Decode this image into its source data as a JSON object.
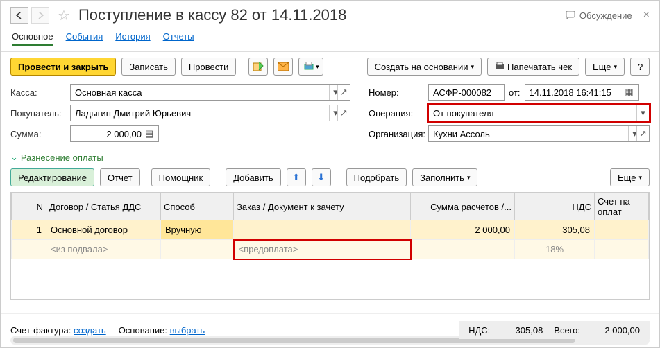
{
  "header": {
    "title": "Поступление в кассу 82 от 14.11.2018",
    "discuss": "Обсуждение"
  },
  "tabs": [
    "Основное",
    "События",
    "История",
    "Отчеты"
  ],
  "toolbar": {
    "post_close": "Провести и закрыть",
    "save": "Записать",
    "post": "Провести",
    "create_basis": "Создать на основании",
    "print_check": "Напечатать чек",
    "more": "Еще",
    "help": "?"
  },
  "form": {
    "kassa_lbl": "Касса:",
    "kassa_val": "Основная касса",
    "nomer_lbl": "Номер:",
    "nomer_val": "АСФР-000082",
    "ot_lbl": "от:",
    "date_val": "14.11.2018 16:41:15",
    "buyer_lbl": "Покупатель:",
    "buyer_val": "Ладыгин Дмитрий Юрьевич",
    "oper_lbl": "Операция:",
    "oper_val": "От покупателя",
    "sum_lbl": "Сумма:",
    "sum_val": "2 000,00",
    "org_lbl": "Организация:",
    "org_val": "Кухни Ассоль"
  },
  "section": "Разнесение оплаты",
  "tb2": {
    "edit": "Редактирование",
    "report": "Отчет",
    "helper": "Помощник",
    "add": "Добавить",
    "pick": "Подобрать",
    "fill": "Заполнить",
    "more": "Еще"
  },
  "cols": {
    "n": "N",
    "contract": "Договор / Статья ДДС",
    "method": "Способ",
    "order": "Заказ / Документ к зачету",
    "sum": "Сумма расчетов /...",
    "vat": "НДС",
    "invoice": "Счет на оплат"
  },
  "row1": {
    "n": "1",
    "contract": "Основной договор",
    "method": "Вручную",
    "order": "",
    "sum": "2 000,00",
    "vat": "305,08",
    "invoice": ""
  },
  "row2": {
    "contract": "<из подвала>",
    "order": "<предоплата>",
    "vat": "18%"
  },
  "footer": {
    "sf_lbl": "Счет-фактура:",
    "sf_link": "создать",
    "osn_lbl": "Основание:",
    "osn_link": "выбрать",
    "vat_lbl": "НДС:",
    "vat_val": "305,08",
    "total_lbl": "Всего:",
    "total_val": "2 000,00"
  }
}
